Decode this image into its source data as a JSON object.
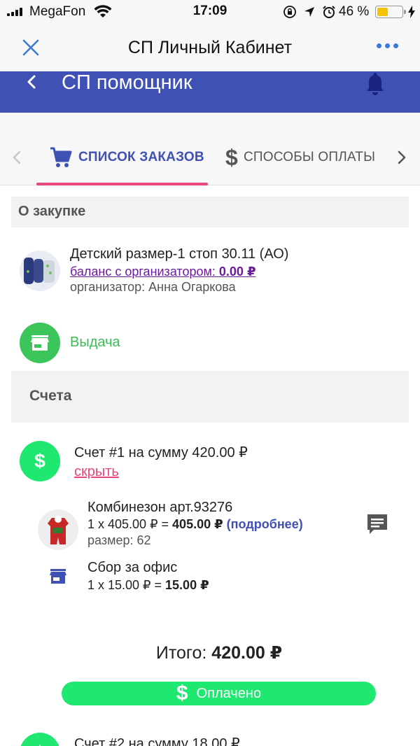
{
  "status_bar": {
    "carrier": "MegaFon",
    "time": "17:09",
    "battery_percent": "46 %",
    "battery_level": 0.46,
    "icons": [
      "signal-icon",
      "wifi-icon",
      "rotation-lock-icon",
      "location-icon",
      "alarm-icon",
      "battery-icon",
      "charging-icon"
    ]
  },
  "browser_header": {
    "title": "СП Личный Кабинет",
    "close_icon": "close-icon",
    "more_icon": "more-icon"
  },
  "app_bar": {
    "title": "СП помощник",
    "back_icon": "chevron-left-icon",
    "bell_icon": "bell-icon",
    "color": "#3f51b5"
  },
  "tabs": {
    "items": [
      {
        "label": "СПИСОК ЗАКАЗОВ",
        "icon": "cart-icon",
        "active": true
      },
      {
        "label": "СПОСОБЫ ОПЛАТЫ",
        "icon": "dollar-icon",
        "active": false
      }
    ],
    "indicator_color": "#e6487c"
  },
  "about": {
    "header": "О закупке",
    "purchase": {
      "title": "Детский размер-1 стоп 30.11 (АО)",
      "balance_label": "баланс с организатором:",
      "balance_value": "0.00 ₽",
      "organizer": "организатор: Анна Огаркова"
    },
    "delivery": {
      "label": "Выдача",
      "icon": "store-icon",
      "color": "#3cc55a"
    }
  },
  "accounts": {
    "header": "Счета",
    "bill1": {
      "title": "Счет #1 на сумму 420.00 ₽",
      "hide_label": "скрыть",
      "item": {
        "title": "Комбинезон арт.93276",
        "price_calc": "1 x 405.00 ₽ = ",
        "price_total": "405.00 ₽",
        "more": "(подробнее)",
        "size": "размер: 62"
      },
      "fee": {
        "title": "Сбор за офис",
        "price_calc": "1 x 15.00 ₽ = ",
        "price_total": "15.00 ₽"
      },
      "total_label": "Итого: ",
      "total_value": "420.00 ₽",
      "paid_label": "Оплачено"
    },
    "bill2": {
      "title": "Счет #2 на сумму 18.00 ₽"
    },
    "accent_color": "#1ee870"
  }
}
